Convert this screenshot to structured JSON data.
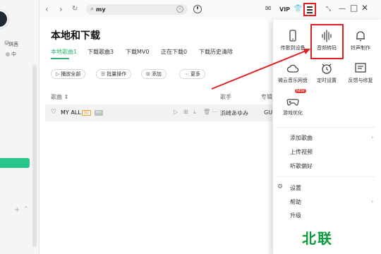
{
  "sidebar": {
    "name_text": "琪茜",
    "status_text": "中"
  },
  "topbar": {
    "search_value": "my",
    "vip_label": "VIP"
  },
  "main": {
    "title": "本地和下载",
    "tabs": [
      "本地歌曲1",
      "下载歌曲3",
      "下载MV0",
      "正在下载0",
      "下载历史清除"
    ],
    "actions": [
      "播放全部",
      "批量操作",
      "添加",
      "更多"
    ],
    "columns": [
      "歌曲",
      "歌手",
      "专辑"
    ],
    "songs": [
      {
        "title": "MY ALL",
        "sq": "SQ",
        "mv": "MV",
        "artist": "浜崎あゆみ",
        "album": "GU"
      }
    ]
  },
  "panel": {
    "grid": [
      {
        "label": "传歌到设备",
        "icon": "phone-icon"
      },
      {
        "label": "音频转码",
        "icon": "audio-wave-icon"
      },
      {
        "label": "铃声制作",
        "icon": "bell-icon"
      },
      {
        "label": "微云音乐网盘",
        "icon": "cloud-icon"
      },
      {
        "label": "定时设置",
        "icon": "alarm-icon"
      },
      {
        "label": "反馈与修复",
        "icon": "feedback-icon"
      },
      {
        "label": "游戏优化",
        "icon": "gamepad-icon"
      }
    ],
    "new_badge": "NEW",
    "menu1": [
      "添加歌曲",
      "上传视频",
      "听歌偏好"
    ],
    "menu2": [
      "设置",
      "帮助",
      "升级"
    ]
  },
  "watermark": "北联",
  "colors": {
    "accent_green": "#2bb673",
    "highlight_red": "#e02020",
    "watermark_green": "#0a9b3c"
  }
}
